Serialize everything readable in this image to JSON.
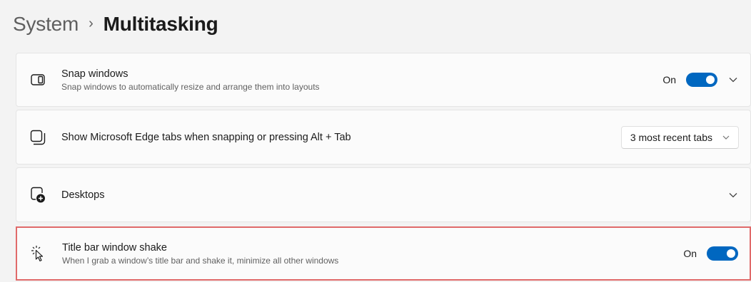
{
  "breadcrumb": {
    "parent": "System",
    "separator": "›",
    "current": "Multitasking"
  },
  "settings": {
    "snap_windows": {
      "title": "Snap windows",
      "description": "Snap windows to automatically resize and arrange them into layouts",
      "state_label": "On",
      "enabled": true,
      "icon": "snap-windows-icon"
    },
    "edge_tabs": {
      "title": "Show Microsoft Edge tabs when snapping or pressing Alt + Tab",
      "dropdown_value": "3 most recent tabs",
      "icon": "edge-tabs-icon"
    },
    "desktops": {
      "title": "Desktops",
      "icon": "desktops-icon"
    },
    "title_bar_shake": {
      "title": "Title bar window shake",
      "description": "When I grab a window’s title bar and shake it, minimize all other windows",
      "state_label": "On",
      "enabled": true,
      "icon": "cursor-shake-icon"
    }
  },
  "colors": {
    "accent": "#0067c0",
    "highlight_border": "#e06a6a",
    "background": "#f3f3f3",
    "card": "#fbfbfb"
  }
}
